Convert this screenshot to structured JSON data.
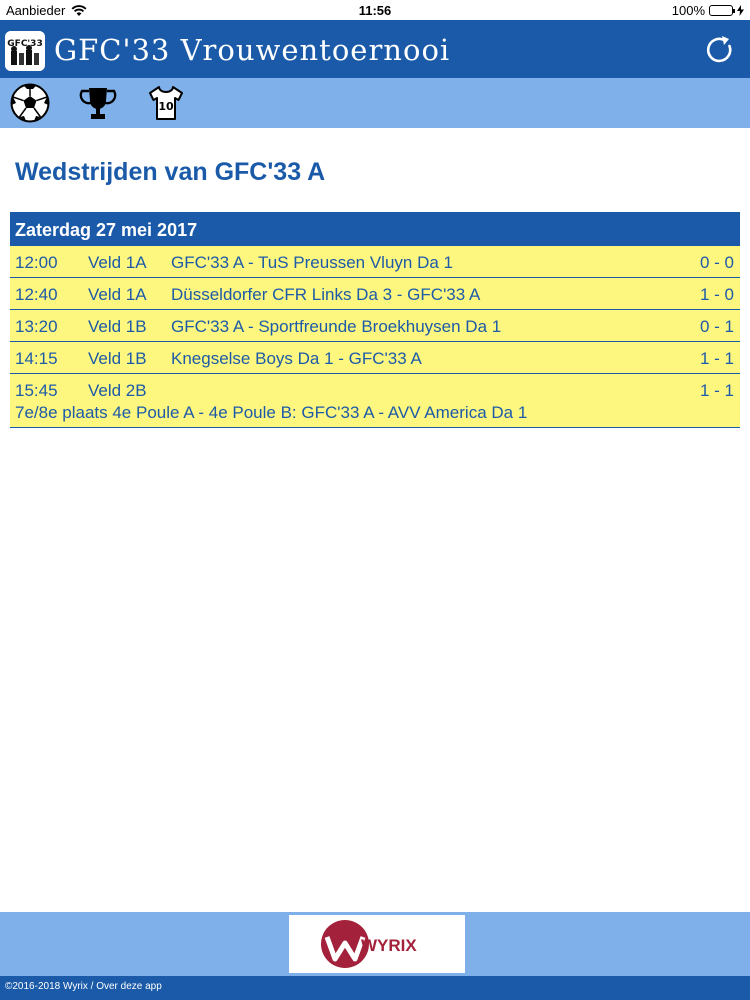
{
  "status_bar": {
    "carrier": "Aanbieder",
    "time": "11:56",
    "battery": "100%"
  },
  "header": {
    "title": "GFC'33 Vrouwentoernooi",
    "logo_text": "GFC'33"
  },
  "nav": {
    "icons": [
      "soccer-ball-icon",
      "trophy-icon",
      "jersey-icon"
    ],
    "jersey_number": "10"
  },
  "page": {
    "title": "Wedstrijden van GFC'33 A"
  },
  "day": {
    "label": "Zaterdag 27 mei 2017"
  },
  "matches": [
    {
      "time": "12:00",
      "field": "Veld 1A",
      "teams": "GFC'33 A - TuS Preussen Vluyn Da 1",
      "score": "0 - 0"
    },
    {
      "time": "12:40",
      "field": "Veld 1A",
      "teams": "Düsseldorfer CFR Links Da 3 - GFC'33 A",
      "score": "1 - 0"
    },
    {
      "time": "13:20",
      "field": "Veld 1B",
      "teams": "GFC'33 A - Sportfreunde Broekhuysen Da 1",
      "score": "0 - 1"
    },
    {
      "time": "14:15",
      "field": "Veld 1B",
      "teams": "Knegselse Boys Da 1 - GFC'33 A",
      "score": "1 - 1"
    },
    {
      "time": "15:45",
      "field": "Veld 2B",
      "teams": "",
      "score": "1 - 1",
      "note": "7e/8e plaats 4e Poule A - 4e Poule B: GFC'33 A - AVV America Da 1"
    }
  ],
  "footer": {
    "sponsor_name": "WYRIX",
    "copyright": "©2016-2018 Wyrix / Over deze app"
  },
  "colors": {
    "header_blue": "#1a5aa8",
    "light_blue": "#7fb0ea",
    "row_yellow": "#fdf67f",
    "sponsor_red": "#a3213a"
  }
}
